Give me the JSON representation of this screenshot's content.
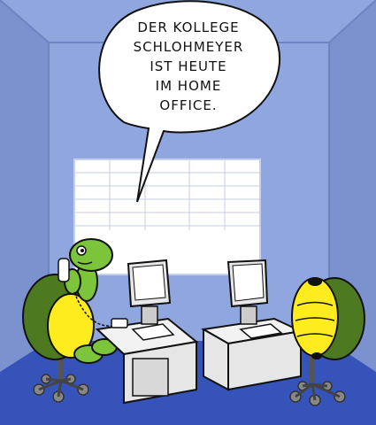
{
  "speech": {
    "lines": [
      "DER KOLLEGE",
      "SCHLOHMEYER",
      "IST HEUTE",
      "IM HOME",
      "OFFICE."
    ]
  },
  "colors": {
    "wall": "#8fa6de",
    "wall_dark": "#7b92cf",
    "floor": "#3553b8",
    "window": "#ffffff",
    "desk": "#eeeeee",
    "shell_dark": "#4d7a20",
    "shell_yellow": "#ffec1f",
    "skin": "#7cc43a"
  },
  "scene": {
    "characters": [
      "turtle-on-phone",
      "empty-shell-chair"
    ],
    "icons": [
      "monitor-icon",
      "keyboard-icon",
      "phone-icon",
      "office-chair-icon"
    ]
  }
}
